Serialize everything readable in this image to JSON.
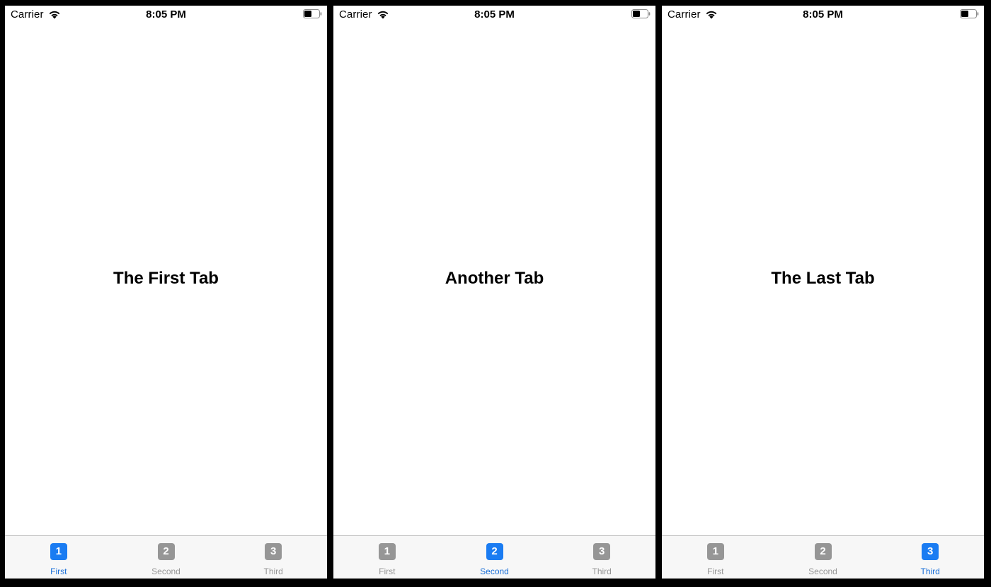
{
  "status_bar": {
    "carrier": "Carrier",
    "time": "8:05 PM",
    "wifi_icon": "wifi-icon",
    "battery_icon": "battery-icon"
  },
  "tabs": [
    {
      "number": "1",
      "label": "First"
    },
    {
      "number": "2",
      "label": "Second"
    },
    {
      "number": "3",
      "label": "Third"
    }
  ],
  "screens": [
    {
      "title": "The First Tab",
      "selected_tab": "First"
    },
    {
      "title": "Another Tab",
      "selected_tab": "Second"
    },
    {
      "title": "The Last Tab",
      "selected_tab": "Third"
    }
  ],
  "colors": {
    "active": "#1a7cf2",
    "inactive": "#969696",
    "tab_bar_background": "#f7f7f7"
  }
}
